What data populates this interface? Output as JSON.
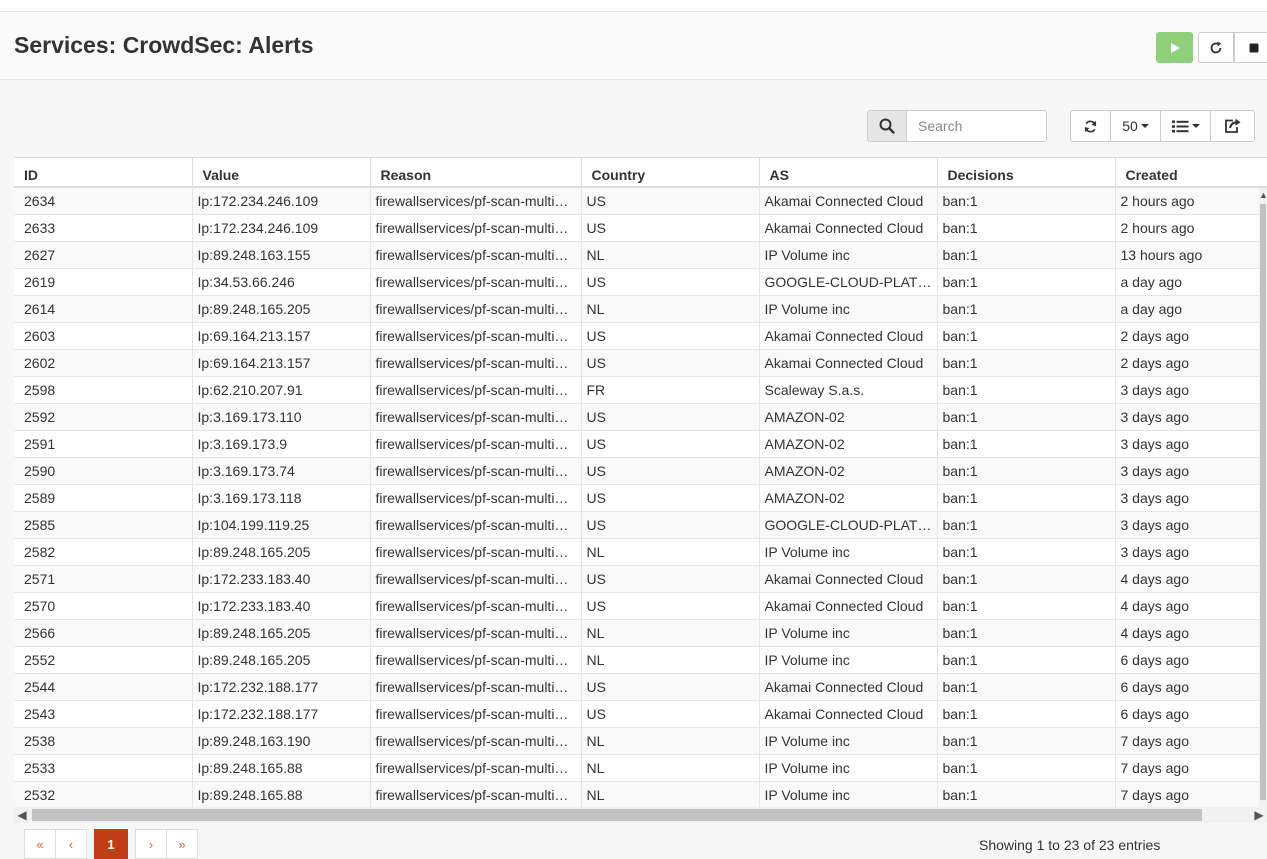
{
  "page": {
    "title": "Services: CrowdSec: Alerts"
  },
  "service_controls": [
    {
      "name": "start-service-button",
      "icon": "play-icon",
      "color": "#8fd17b"
    },
    {
      "name": "restart-service-button",
      "icon": "refresh-icon"
    },
    {
      "name": "stop-service-button",
      "icon": "stop-icon"
    }
  ],
  "toolbar": {
    "search_placeholder": "Search",
    "page_size": "50",
    "refresh_icon": "refresh-icon",
    "columns_icon": "list-icon",
    "export_icon": "export-icon"
  },
  "table": {
    "columns": [
      "ID",
      "Value",
      "Reason",
      "Country",
      "AS",
      "Decisions",
      "Created"
    ],
    "rows": [
      [
        "2634",
        "Ip:172.234.246.109",
        "firewallservices/pf-scan-multi…",
        "US",
        "Akamai Connected Cloud",
        "ban:1",
        "2 hours ago"
      ],
      [
        "2633",
        "Ip:172.234.246.109",
        "firewallservices/pf-scan-multi…",
        "US",
        "Akamai Connected Cloud",
        "ban:1",
        "2 hours ago"
      ],
      [
        "2627",
        "Ip:89.248.163.155",
        "firewallservices/pf-scan-multi…",
        "NL",
        "IP Volume inc",
        "ban:1",
        "13 hours ago"
      ],
      [
        "2619",
        "Ip:34.53.66.246",
        "firewallservices/pf-scan-multi…",
        "US",
        "GOOGLE-CLOUD-PLATF…",
        "ban:1",
        "a day ago"
      ],
      [
        "2614",
        "Ip:89.248.165.205",
        "firewallservices/pf-scan-multi…",
        "NL",
        "IP Volume inc",
        "ban:1",
        "a day ago"
      ],
      [
        "2603",
        "Ip:69.164.213.157",
        "firewallservices/pf-scan-multi…",
        "US",
        "Akamai Connected Cloud",
        "ban:1",
        "2 days ago"
      ],
      [
        "2602",
        "Ip:69.164.213.157",
        "firewallservices/pf-scan-multi…",
        "US",
        "Akamai Connected Cloud",
        "ban:1",
        "2 days ago"
      ],
      [
        "2598",
        "Ip:62.210.207.91",
        "firewallservices/pf-scan-multi…",
        "FR",
        "Scaleway S.a.s.",
        "ban:1",
        "3 days ago"
      ],
      [
        "2592",
        "Ip:3.169.173.110",
        "firewallservices/pf-scan-multi…",
        "US",
        "AMAZON-02",
        "ban:1",
        "3 days ago"
      ],
      [
        "2591",
        "Ip:3.169.173.9",
        "firewallservices/pf-scan-multi…",
        "US",
        "AMAZON-02",
        "ban:1",
        "3 days ago"
      ],
      [
        "2590",
        "Ip:3.169.173.74",
        "firewallservices/pf-scan-multi…",
        "US",
        "AMAZON-02",
        "ban:1",
        "3 days ago"
      ],
      [
        "2589",
        "Ip:3.169.173.118",
        "firewallservices/pf-scan-multi…",
        "US",
        "AMAZON-02",
        "ban:1",
        "3 days ago"
      ],
      [
        "2585",
        "Ip:104.199.119.25",
        "firewallservices/pf-scan-multi…",
        "US",
        "GOOGLE-CLOUD-PLATF…",
        "ban:1",
        "3 days ago"
      ],
      [
        "2582",
        "Ip:89.248.165.205",
        "firewallservices/pf-scan-multi…",
        "NL",
        "IP Volume inc",
        "ban:1",
        "3 days ago"
      ],
      [
        "2571",
        "Ip:172.233.183.40",
        "firewallservices/pf-scan-multi…",
        "US",
        "Akamai Connected Cloud",
        "ban:1",
        "4 days ago"
      ],
      [
        "2570",
        "Ip:172.233.183.40",
        "firewallservices/pf-scan-multi…",
        "US",
        "Akamai Connected Cloud",
        "ban:1",
        "4 days ago"
      ],
      [
        "2566",
        "Ip:89.248.165.205",
        "firewallservices/pf-scan-multi…",
        "NL",
        "IP Volume inc",
        "ban:1",
        "4 days ago"
      ],
      [
        "2552",
        "Ip:89.248.165.205",
        "firewallservices/pf-scan-multi…",
        "NL",
        "IP Volume inc",
        "ban:1",
        "6 days ago"
      ],
      [
        "2544",
        "Ip:172.232.188.177",
        "firewallservices/pf-scan-multi…",
        "US",
        "Akamai Connected Cloud",
        "ban:1",
        "6 days ago"
      ],
      [
        "2543",
        "Ip:172.232.188.177",
        "firewallservices/pf-scan-multi…",
        "US",
        "Akamai Connected Cloud",
        "ban:1",
        "6 days ago"
      ],
      [
        "2538",
        "Ip:89.248.163.190",
        "firewallservices/pf-scan-multi…",
        "NL",
        "IP Volume inc",
        "ban:1",
        "7 days ago"
      ],
      [
        "2533",
        "Ip:89.248.165.88",
        "firewallservices/pf-scan-multi…",
        "NL",
        "IP Volume inc",
        "ban:1",
        "7 days ago"
      ],
      [
        "2532",
        "Ip:89.248.165.88",
        "firewallservices/pf-scan-multi…",
        "NL",
        "IP Volume inc",
        "ban:1",
        "7 days ago"
      ]
    ]
  },
  "pagination": {
    "first": "«",
    "prev": "‹",
    "current": "1",
    "next": "›",
    "last": "»",
    "summary": "Showing 1 to 23 of 23 entries"
  },
  "colors": {
    "accent": "#c03e14",
    "start_button": "#8fd17b"
  }
}
